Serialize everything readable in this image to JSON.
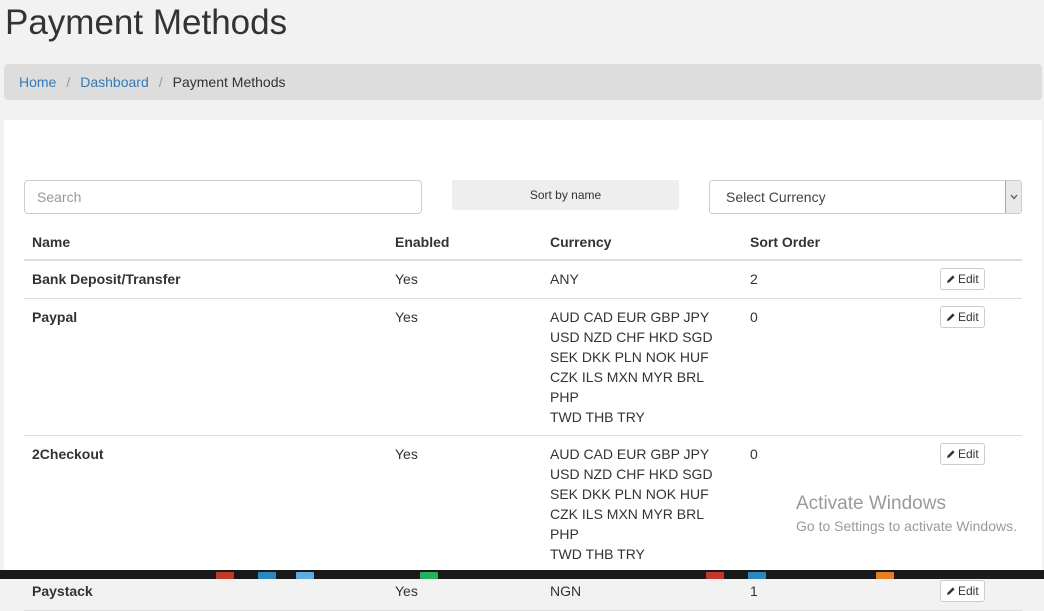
{
  "page": {
    "title": "Payment Methods"
  },
  "breadcrumb": {
    "items": [
      "Home",
      "Dashboard"
    ],
    "active": "Payment Methods",
    "separator": "/"
  },
  "toolbar": {
    "search_placeholder": "Search",
    "sort_label": "Sort by name",
    "currency_select_value": "Select Currency"
  },
  "table": {
    "headers": [
      "Name",
      "Enabled",
      "Currency",
      "Sort Order",
      ""
    ],
    "edit_label": "Edit",
    "rows": [
      {
        "name": "Bank Deposit/Transfer",
        "enabled": "Yes",
        "currency_lines": [
          "ANY"
        ],
        "sort_order": "2"
      },
      {
        "name": "Paypal",
        "enabled": "Yes",
        "currency_lines": [
          "AUD CAD EUR GBP JPY",
          "USD NZD CHF HKD SGD",
          "SEK DKK PLN NOK HUF",
          "CZK ILS MXN MYR BRL PHP",
          "TWD THB TRY"
        ],
        "sort_order": "0"
      },
      {
        "name": "2Checkout",
        "enabled": "Yes",
        "currency_lines": [
          "AUD CAD EUR GBP JPY",
          "USD NZD CHF HKD SGD",
          "SEK DKK PLN NOK HUF",
          "CZK ILS MXN MYR BRL PHP",
          "TWD THB TRY"
        ],
        "sort_order": "0"
      },
      {
        "name": "Paystack",
        "enabled": "Yes",
        "currency_lines": [
          "NGN"
        ],
        "sort_order": "1"
      }
    ]
  },
  "watermark": {
    "title": "Activate Windows",
    "subtitle": "Go to Settings to activate Windows."
  },
  "icons": {
    "edit": "pencil-icon",
    "select_arrow": "chevron-down-icon"
  },
  "colors": {
    "link": "#337ab7",
    "breadcrumb_bg": "#dddddd",
    "page_bg": "#f2f2f2",
    "panel_bg": "#ffffff"
  }
}
